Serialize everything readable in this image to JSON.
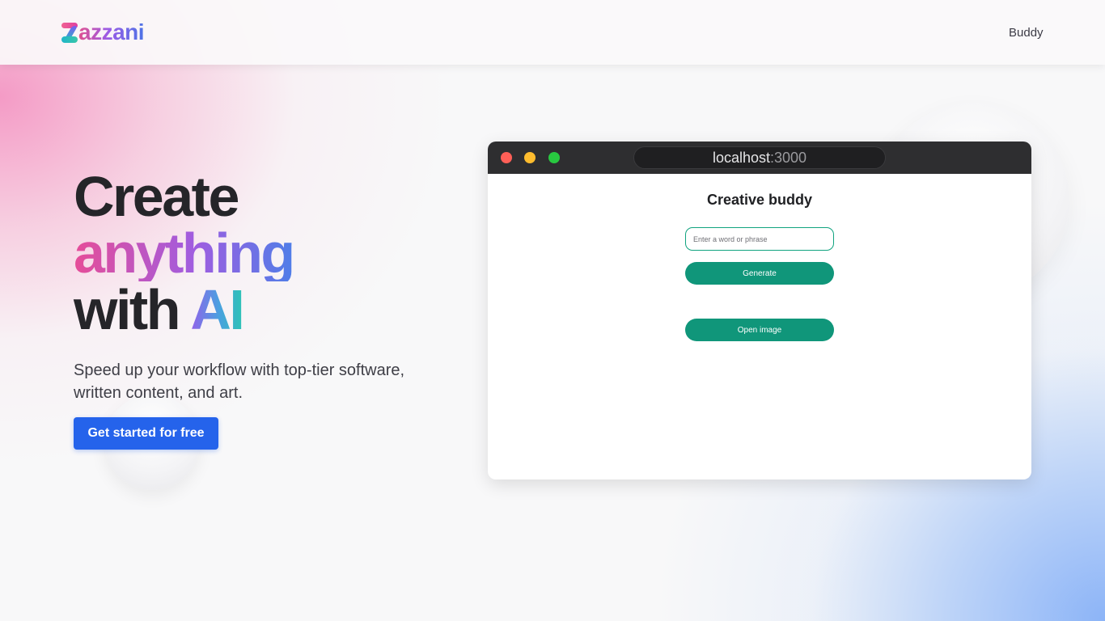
{
  "header": {
    "logo_text": "azzani",
    "nav_link": "Buddy"
  },
  "hero": {
    "line1": "Create",
    "line2": "anything",
    "line3_prefix": "with",
    "line3_accent": "AI",
    "subtitle": "Speed up your workflow with top-tier software, written content, and art.",
    "cta_label": "Get started for free"
  },
  "browser": {
    "url_host": "localhost",
    "url_port": ":3000",
    "app_title": "Creative buddy",
    "input_placeholder": "Enter a word or phrase",
    "generate_label": "Generate",
    "open_image_label": "Open image"
  },
  "colors": {
    "cta": "#2563eb",
    "app_button": "#10967a",
    "traffic_red": "#fe5f57",
    "traffic_yellow": "#febc2e",
    "traffic_green": "#28c840"
  }
}
